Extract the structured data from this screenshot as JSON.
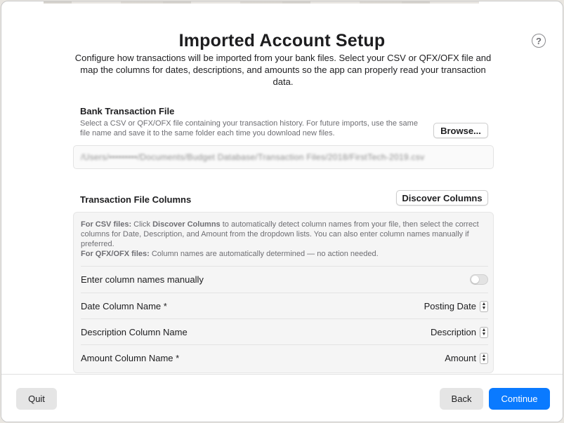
{
  "header": {
    "title": "Imported Account Setup",
    "subtitle": "Configure how transactions will be imported from your bank files. Select your CSV or QFX/OFX file and map the columns for dates, descriptions, and amounts so the app can properly read your transaction data.",
    "help_label": "?"
  },
  "file_section": {
    "label": "Bank Transaction File",
    "hint": "Select a CSV or QFX/OFX file containing your transaction history. For future imports, use the same file name and save it to the same folder each time you download new files.",
    "browse_label": "Browse...",
    "path_value": "/Users/•••••••••/Documents/Budget Database/Transaction Files/2018/FirstTech-2019.csv"
  },
  "columns_section": {
    "label": "Transaction File Columns",
    "discover_label": "Discover Columns",
    "info_csv_prefix": "For CSV files:",
    "info_csv_pre": " Click ",
    "info_csv_bold": "Discover Columns",
    "info_csv_post": " to automatically detect column names from your file, then select the correct columns for Date, Description, and Amount from the dropdown lists. You can also enter column names manually if preferred.",
    "info_qfx_prefix": "For QFX/OFX files:",
    "info_qfx_text": " Column names are automatically determined — no action needed.",
    "manual_label": "Enter column names manually",
    "manual_enabled": false,
    "rows": [
      {
        "label": "Date Column Name *",
        "value": "Posting Date"
      },
      {
        "label": "Description Column Name",
        "value": "Description"
      },
      {
        "label": "Amount Column Name *",
        "value": "Amount"
      }
    ]
  },
  "footer": {
    "quit_label": "Quit",
    "back_label": "Back",
    "continue_label": "Continue"
  },
  "colors": {
    "accent": "#0a7aff",
    "window_bg": "#ffffff",
    "panel_bg": "#f5f5f5"
  }
}
